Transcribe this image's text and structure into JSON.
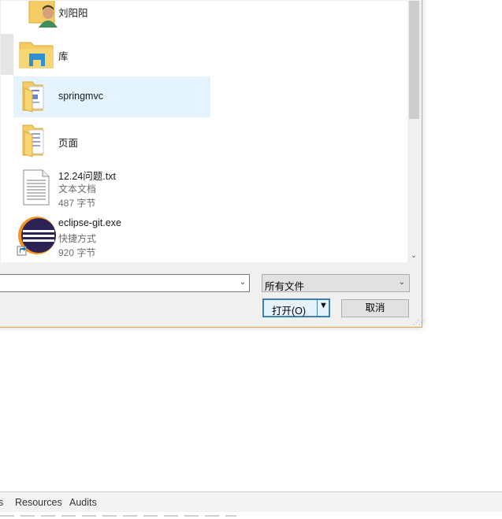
{
  "file_list": {
    "items": [
      {
        "name": "刘阳阳",
        "icon": "user-folder-icon",
        "selected": false
      },
      {
        "name": "库",
        "icon": "library-folder-icon",
        "selected": false
      },
      {
        "name": "springmvc",
        "icon": "folder-icon",
        "selected": true
      },
      {
        "name": "页面",
        "icon": "folder-icon",
        "selected": false
      },
      {
        "name": "12.24问题.txt",
        "type": "文本文档",
        "size": "487 字节",
        "icon": "text-file-icon"
      },
      {
        "name": "eclipse-git.exe",
        "type": "快捷方式",
        "size": "920 字节",
        "icon": "eclipse-shortcut-icon"
      }
    ]
  },
  "controls": {
    "filename_value": "",
    "filter_value": "所有文件",
    "open_label": "打开(O)",
    "cancel_label": "取消"
  },
  "devtools": {
    "tabs": [
      "s",
      "Resources",
      "Audits"
    ]
  },
  "colors": {
    "selection": "#e5f3ff",
    "folder": "#f4cc62",
    "dialog_border": "#e0a84a",
    "button_focus": "#3c7fb1"
  }
}
